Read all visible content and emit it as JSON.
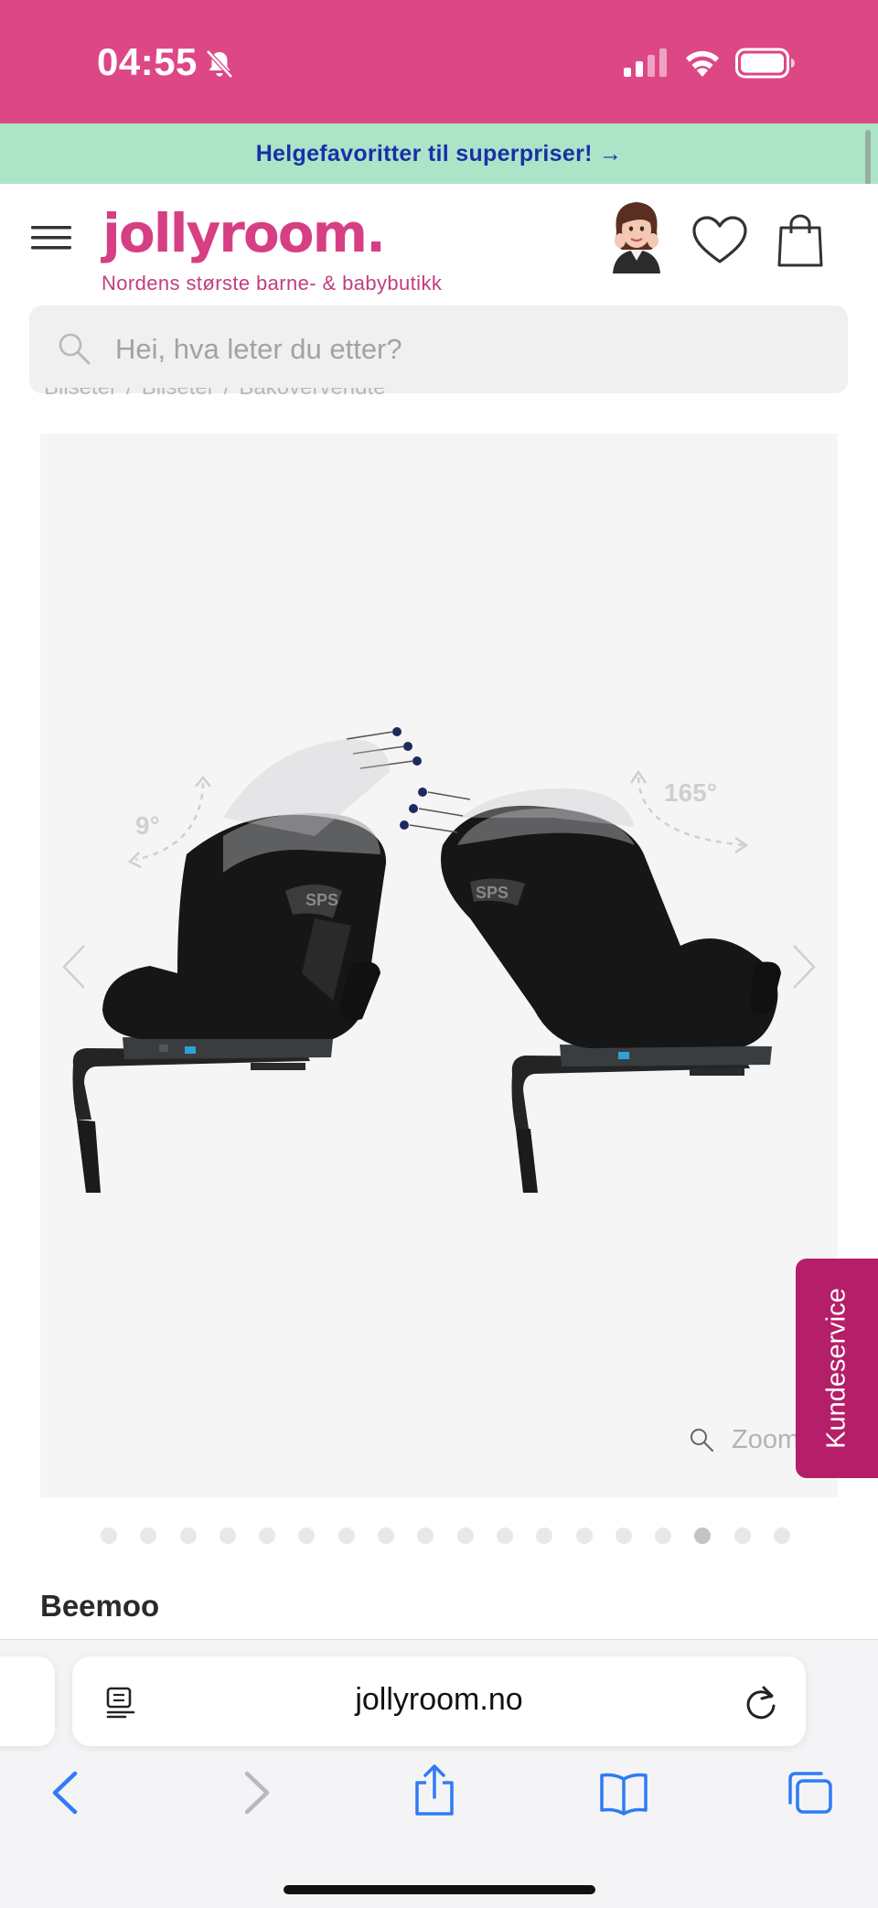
{
  "status_bar": {
    "time": "04:55",
    "icons": [
      "bell-slash-icon",
      "signal-icon",
      "wifi-icon",
      "battery-icon"
    ],
    "color": "#de4785"
  },
  "promo": {
    "text": "Helgefavoritter til superpriser! →",
    "background": "#ace4c7",
    "text_color": "#1a2fa8"
  },
  "header": {
    "logo": "jollyroom.",
    "tagline": "Nordens største barne- & babybutikk",
    "brand_color": "#d63f83",
    "icons": [
      "menu-icon",
      "avatar",
      "heart-icon",
      "shopping-bag-icon"
    ]
  },
  "search": {
    "placeholder": "Hei, hva leter du etter?"
  },
  "breadcrumb": {
    "items": [
      "Bilseter",
      "Bilseter",
      "Bakovervendte"
    ]
  },
  "product": {
    "image_labels": [
      "9°",
      "165°",
      "SPS",
      "SPS"
    ],
    "zoom_label": "Zoom",
    "image_count": 18,
    "active_image_index": 15,
    "brand": "Beemoo"
  },
  "support": {
    "label": "Kundeservice",
    "color": "#b51e68"
  },
  "browser": {
    "url": "jollyroom.no",
    "toolbar": [
      "back-icon",
      "forward-icon",
      "share-icon",
      "bookmarks-icon",
      "tabs-icon"
    ]
  }
}
